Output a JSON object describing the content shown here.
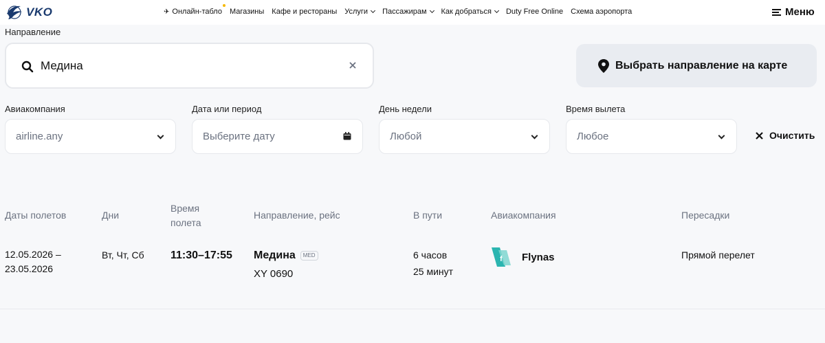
{
  "header": {
    "logo_text": "VKO",
    "nav": [
      {
        "label": "Онлайн-табло",
        "has_chevron": false
      },
      {
        "label": "Магазины",
        "has_chevron": false
      },
      {
        "label": "Кафе и рестораны",
        "has_chevron": false
      },
      {
        "label": "Услуги",
        "has_chevron": true
      },
      {
        "label": "Пассажирам",
        "has_chevron": true
      },
      {
        "label": "Как добраться",
        "has_chevron": true
      },
      {
        "label": "Duty Free Online",
        "has_chevron": false
      },
      {
        "label": "Схема аэропорта",
        "has_chevron": false
      }
    ],
    "menu_label": "Меню"
  },
  "search": {
    "label": "Направление",
    "value": "Медина",
    "map_button": "Выбрать направление на карте"
  },
  "filters": {
    "airline": {
      "label": "Авиакомпания",
      "value": "airline.any"
    },
    "date": {
      "label": "Дата или период",
      "placeholder": "Выберите дату"
    },
    "weekday": {
      "label": "День недели",
      "value": "Любой"
    },
    "departure_time": {
      "label": "Время вылета",
      "value": "Любое"
    },
    "clear_label": "Очистить"
  },
  "table": {
    "headers": {
      "dates": "Даты полетов",
      "days": "Дни",
      "time_line1": "Время",
      "time_line2": "полета",
      "route": "Направление, рейс",
      "duration": "В пути",
      "airline": "Авиакомпания",
      "transfers": "Пересадки"
    },
    "rows": [
      {
        "dates_line1": "12.05.2026 –",
        "dates_line2": "23.05.2026",
        "days": "Вт, Чт, Сб",
        "time": "11:30–17:55",
        "destination": "Медина",
        "code": "MED",
        "flight": "XY 0690",
        "duration_line1": "6 часов",
        "duration_line2": "25 минут",
        "airline": "Flynas",
        "transfers": "Прямой перелет"
      }
    ]
  },
  "colors": {
    "logo": "#1a3a6e",
    "airline_logo": "#2bb5b0",
    "notification_dot": "#f5b800"
  }
}
